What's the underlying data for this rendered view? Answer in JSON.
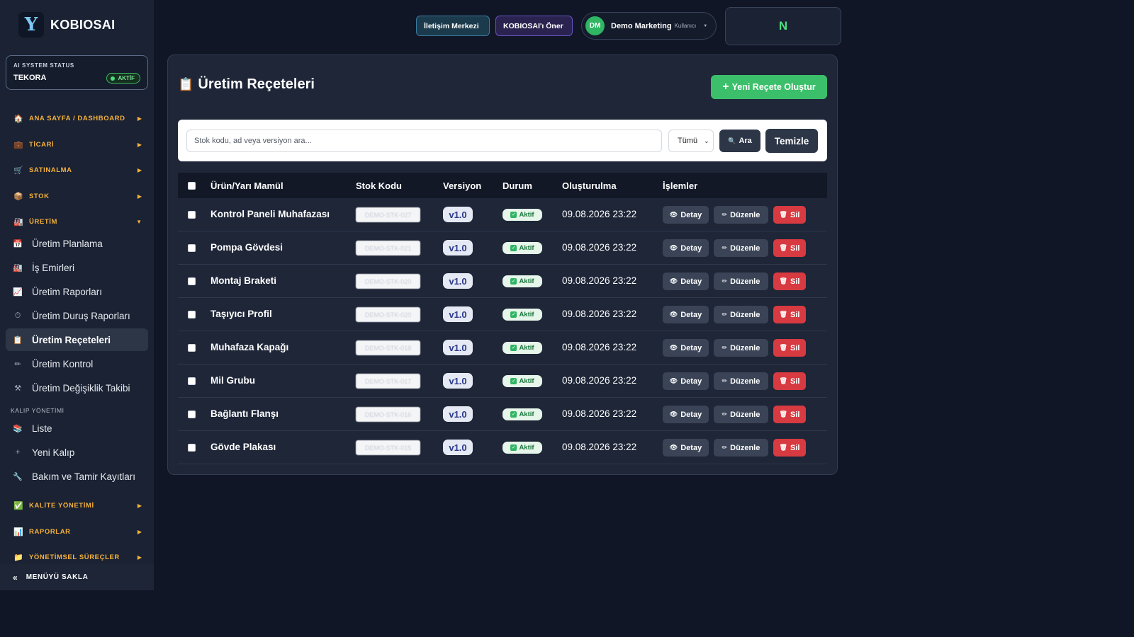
{
  "brand": {
    "name": "KOBIOSAI",
    "mark": "Y"
  },
  "ai_status": {
    "label": "AI SYSTEM STATUS",
    "value": "TEKORA",
    "badge": "AKTİF"
  },
  "sidebar": {
    "sections_top": [
      {
        "label": "ANA SAYFA / DASHBOARD",
        "icon": "home-icon",
        "glyph": "🏠",
        "arrow": "▶"
      },
      {
        "label": "TİCARİ",
        "icon": "cash-register-icon",
        "glyph": "💼",
        "arrow": "▶"
      },
      {
        "label": "SATINALMA",
        "icon": "cart-icon",
        "glyph": "🛒",
        "arrow": "▶"
      },
      {
        "label": "STOK",
        "icon": "box-icon",
        "glyph": "📦",
        "arrow": "▶"
      },
      {
        "label": "ÜRETİM",
        "icon": "factory-icon",
        "glyph": "🏭",
        "arrow": "▼"
      }
    ],
    "production_items": [
      {
        "label": "Üretim Planlama",
        "icon": "calendar-icon",
        "glyph": "📅"
      },
      {
        "label": "İş Emirleri",
        "icon": "factory-icon",
        "glyph": "🏭"
      },
      {
        "label": "Üretim Raporları",
        "icon": "chart-up-icon",
        "glyph": "📈"
      },
      {
        "label": "Üretim Duruş Raporları",
        "icon": "stopwatch-icon",
        "glyph": "⏱"
      },
      {
        "label": "Üretim Reçeteleri",
        "icon": "clipboard-icon",
        "glyph": "📋",
        "active": true
      },
      {
        "label": "Üretim Kontrol",
        "icon": "pencil-icon",
        "glyph": "✏"
      },
      {
        "label": "Üretim Değişiklik Takibi",
        "icon": "tools-icon",
        "glyph": "⚒"
      }
    ],
    "mold_caption": "KALIP YÖNETİMİ",
    "mold_items": [
      {
        "label": "Liste",
        "icon": "stack-icon",
        "glyph": "📚"
      },
      {
        "label": "Yeni Kalıp",
        "icon": "plus-icon",
        "glyph": "+"
      },
      {
        "label": "Bakım ve Tamir Kayıtları",
        "icon": "wrench-icon",
        "glyph": "🔧"
      }
    ],
    "sections_bottom": [
      {
        "label": "KALİTE YÖNETİMİ",
        "icon": "check-icon",
        "glyph": "✅",
        "arrow": "▶"
      },
      {
        "label": "RAPORLAR",
        "icon": "bar-chart-icon",
        "glyph": "📊",
        "arrow": "▶"
      },
      {
        "label": "YÖNETİMSEL SÜREÇLER",
        "icon": "folder-icon",
        "glyph": "📁",
        "arrow": "▶"
      }
    ],
    "hide_menu": {
      "label": "MENÜYÜ SAKLA",
      "glyph": "«"
    }
  },
  "topbar": {
    "contact_button": "İletişim Merkezi",
    "recommend_button": "KOBIOSAI'ı Öner",
    "user": {
      "initials": "DM",
      "name": "Demo Marketing",
      "role": "Kullanıcı"
    },
    "n_box": "N"
  },
  "page": {
    "title": "Üretim Reçeteleri",
    "title_glyph": "📋",
    "new_button": "Yeni Reçete Oluştur"
  },
  "search": {
    "placeholder": "Stok kodu, ad veya versiyon ara...",
    "filter_value": "Tümü",
    "search_button": "Ara",
    "clear_button": "Temizle"
  },
  "table": {
    "headers": [
      "Ürün/Yarı Mamül",
      "Stok Kodu",
      "Versiyon",
      "Durum",
      "Oluşturulma",
      "İşlemler"
    ],
    "actions": {
      "detail": "Detay",
      "edit": "Düzenle",
      "delete": "Sil"
    },
    "rows": [
      {
        "name": "Kontrol Paneli Muhafazası",
        "code": "DEMO-STK-027",
        "version": "v1.0",
        "status": "Aktif",
        "created": "09.08.2026 23:22"
      },
      {
        "name": "Pompa Gövdesi",
        "code": "DEMO-STK-021",
        "version": "v1.0",
        "status": "Aktif",
        "created": "09.08.2026 23:22"
      },
      {
        "name": "Montaj Braketi",
        "code": "DEMO-STK-020",
        "version": "v1.0",
        "status": "Aktif",
        "created": "09.08.2026 23:22"
      },
      {
        "name": "Taşıyıcı Profil",
        "code": "DEMO-STK-020",
        "version": "v1.0",
        "status": "Aktif",
        "created": "09.08.2026 23:22"
      },
      {
        "name": "Muhafaza Kapağı",
        "code": "DEMO-STK-018",
        "version": "v1.0",
        "status": "Aktif",
        "created": "09.08.2026 23:22"
      },
      {
        "name": "Mil Grubu",
        "code": "DEMO-STK-017",
        "version": "v1.0",
        "status": "Aktif",
        "created": "09.08.2026 23:22"
      },
      {
        "name": "Bağlantı Flanşı",
        "code": "DEMO-STK-016",
        "version": "v1.0",
        "status": "Aktif",
        "created": "09.08.2026 23:22"
      },
      {
        "name": "Gövde Plakası",
        "code": "DEMO-STK-015",
        "version": "v1.0",
        "status": "Aktif",
        "created": "09.08.2026 23:22"
      }
    ]
  },
  "colors": {
    "page_bg": "#111627",
    "sidebar_bg": "#1a2233",
    "accent_green": "#3cbf6a",
    "section_label": "#f5b13b",
    "delete_red": "#d73a41"
  }
}
